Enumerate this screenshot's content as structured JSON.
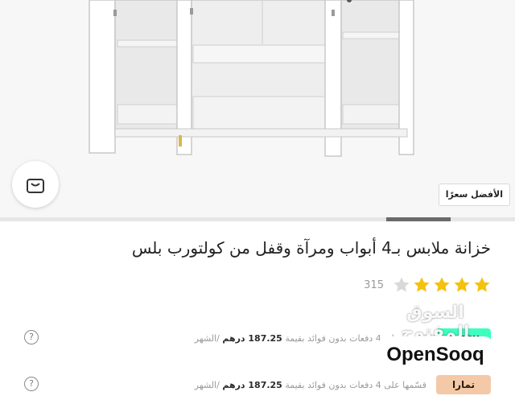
{
  "hero": {
    "image_alt": "wardrobe",
    "best_price_badge": "الأفضل سعرًا",
    "cart_icon": "shopping-bag-icon"
  },
  "gallery": {
    "progress": 0.125,
    "current_index": 7
  },
  "product": {
    "title": "خزانة ملابس بـ4 أبواب ومرآة وقفل من كولتورب بلس",
    "rating": 4,
    "rating_max": 5,
    "review_count": "315"
  },
  "installments": [
    {
      "provider": "tabby",
      "provider_label": "tabby",
      "text_before": "قسّمها على 4 دفعات بدون فوائد بقيمة",
      "amount": "187.25 درهم",
      "text_after": "/الشهر"
    },
    {
      "provider": "tamara",
      "provider_label": "تمارا",
      "text_before": "قسّمها على 4 دفعات بدون فوائد بقيمة",
      "amount": "187.25 درهم",
      "text_after": "/الشهر"
    }
  ],
  "watermark": {
    "arabic": "السوق المفتوح",
    "latin": "OpenSooq"
  },
  "colors": {
    "star": "#f4c20d",
    "progress_active": "#6a6a6a",
    "tabby": "#3cffc0",
    "tamara": "#f4c9a7"
  }
}
